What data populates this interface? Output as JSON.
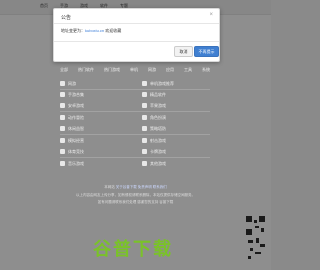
{
  "nav": [
    "首页",
    "手游",
    "游戏",
    "软件",
    "专题"
  ],
  "tabs": [
    "全部",
    "热门软件",
    "热门游戏",
    "单机",
    "网游",
    "应用",
    "工具",
    "系统"
  ],
  "list": [
    "网游",
    "单机游戏推荐",
    "手游合集",
    "精品软件",
    "安卓游戏",
    "苹果游戏",
    "动作冒险",
    "角色扮演",
    "休闲益智",
    "策略塔防",
    "模拟经营",
    "射击游戏",
    "体育竞技",
    "卡牌游戏",
    "音乐游戏",
    "其他游戏"
  ],
  "footer": {
    "line1_a": "本网站",
    "line1_b": "关于谷普下载",
    "line1_c": "免责声明",
    "line1_d": "联系我们",
    "line2": "以上内容由网友上传分享，如有侵权请联系删除，本站仅提供存储空间服务。",
    "line3": "如有问题请联系我们处理 感谢您的支持 谷普下载"
  },
  "dialog": {
    "title": "公告",
    "close": "×",
    "text_prefix": "地址变更为：",
    "text_link": "kuboxiu.cn",
    "text_suffix": " 欢迎收藏",
    "cancel": "取消",
    "ok": "不再提示"
  },
  "watermark": "谷普下载"
}
